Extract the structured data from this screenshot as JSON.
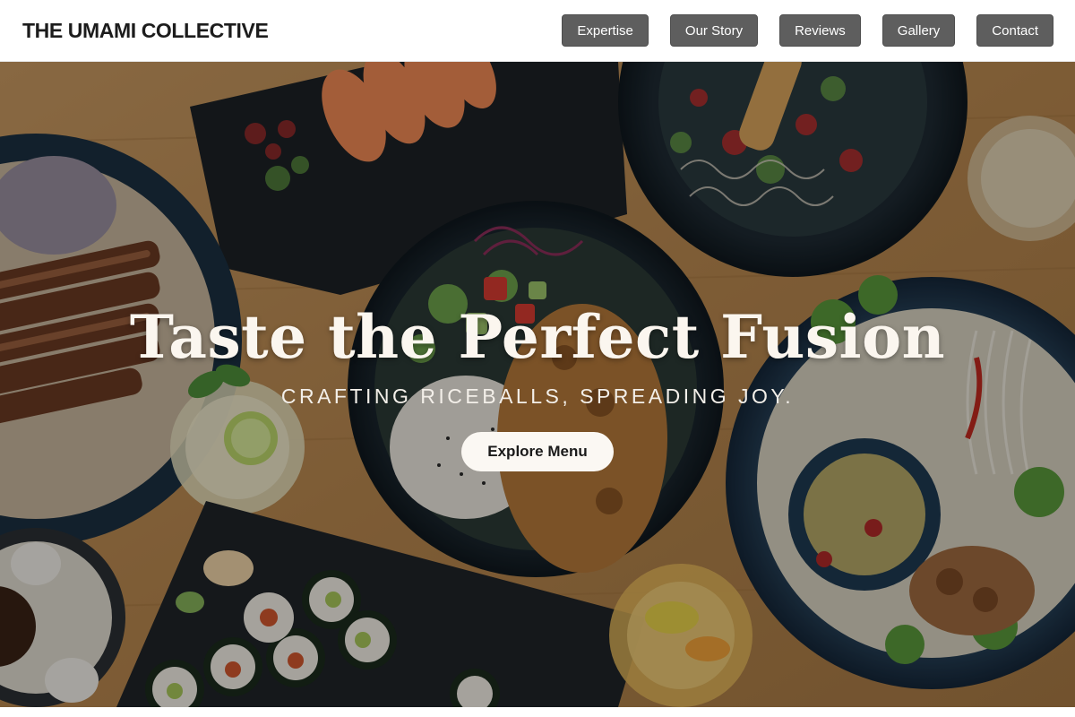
{
  "brand": {
    "name": "THE UMAMI COLLECTIVE"
  },
  "nav": {
    "items": [
      {
        "label": "Expertise"
      },
      {
        "label": "Our Story"
      },
      {
        "label": "Reviews"
      },
      {
        "label": "Gallery"
      },
      {
        "label": "Contact"
      }
    ]
  },
  "hero": {
    "headline": "Taste the Perfect Fusion",
    "tagline": "Crafting Riceballs, Spreading Joy.",
    "cta_label": "Explore Menu",
    "image_subject": "overhead view of Japanese fusion dishes on a wooden table"
  },
  "colors": {
    "nav_button_bg": "#5e5e5e",
    "hero_text": "#fbf6ef",
    "cta_bg": "#fbf8f3",
    "table_wood": "#b98b55"
  }
}
